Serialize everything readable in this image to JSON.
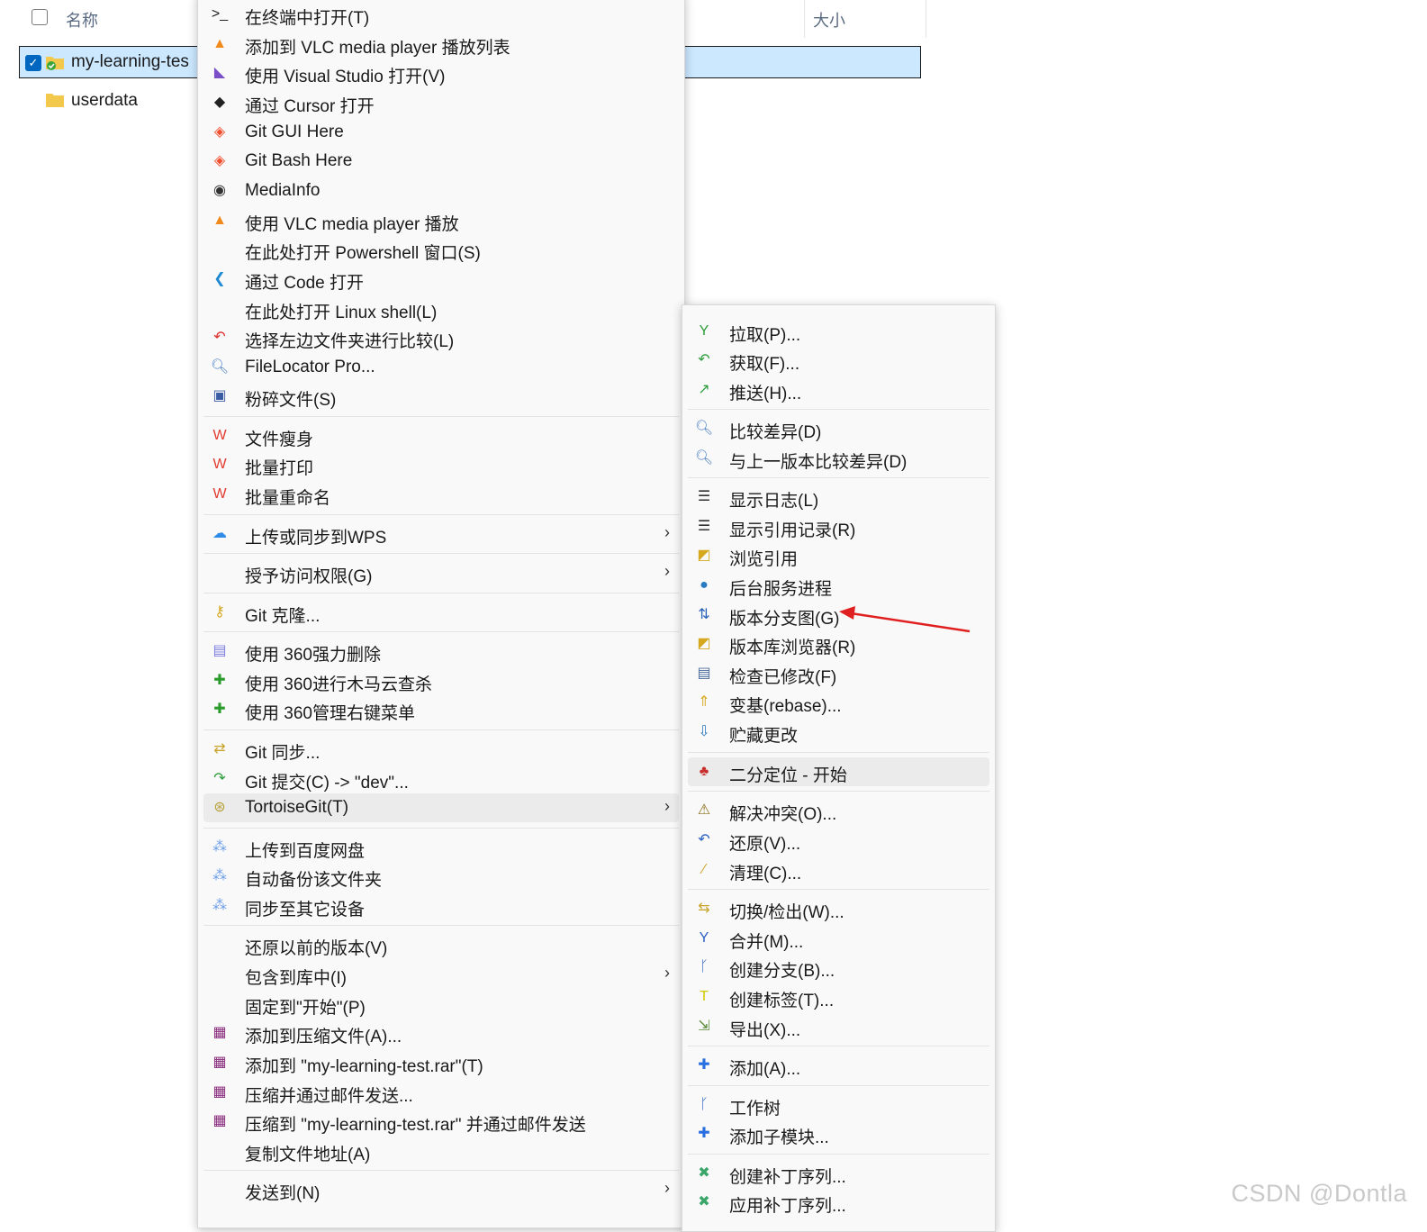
{
  "explorer": {
    "col_name": "名称",
    "col_size": "大小",
    "rows": [
      {
        "name": "my-learning-tes",
        "selected": true
      },
      {
        "name": "userdata",
        "selected": false
      }
    ]
  },
  "main_menu": {
    "items": [
      {
        "icon": "terminal-icon",
        "label": "在终端中打开(T)"
      },
      {
        "icon": "vlc-icon",
        "label": "添加到 VLC media player 播放列表"
      },
      {
        "icon": "visual-studio-icon",
        "label": "使用 Visual Studio 打开(V)"
      },
      {
        "icon": "cursor-icon",
        "label": "通过 Cursor 打开"
      },
      {
        "icon": "git-icon",
        "label": "Git GUI Here"
      },
      {
        "icon": "git-icon",
        "label": "Git Bash Here"
      },
      {
        "icon": "mediainfo-icon",
        "label": "MediaInfo"
      },
      {
        "icon": "vlc-icon",
        "label": "使用 VLC media player 播放"
      },
      {
        "icon": "",
        "label": "在此处打开 Powershell 窗口(S)"
      },
      {
        "icon": "vscode-icon",
        "label": "通过 Code 打开"
      },
      {
        "icon": "",
        "label": "在此处打开 Linux shell(L)"
      },
      {
        "icon": "compare-icon",
        "label": "选择左边文件夹进行比较(L)"
      },
      {
        "icon": "magnifier-icon",
        "label": "FileLocator Pro..."
      },
      {
        "icon": "shred-icon",
        "label": "粉碎文件(S)"
      },
      {
        "icon": "wps-icon",
        "label": "文件瘦身"
      },
      {
        "icon": "wps-icon",
        "label": "批量打印"
      },
      {
        "icon": "wps-icon",
        "label": "批量重命名"
      },
      {
        "icon": "cloud-icon",
        "label": "上传或同步到WPS",
        "sub": true
      },
      {
        "icon": "",
        "label": "授予访问权限(G)",
        "sub": true
      },
      {
        "icon": "git-clone-icon",
        "label": "Git 克隆..."
      },
      {
        "icon": "delete-360-icon",
        "label": "使用 360强力删除"
      },
      {
        "icon": "plus-360-icon",
        "label": "使用 360进行木马云查杀"
      },
      {
        "icon": "plus-360-icon",
        "label": "使用 360管理右键菜单"
      },
      {
        "icon": "git-sync-icon",
        "label": "Git 同步..."
      },
      {
        "icon": "git-commit-icon",
        "label": "Git 提交(C) -> \"dev\"..."
      },
      {
        "icon": "tortoise-icon",
        "label": "TortoiseGit(T)",
        "sub": true,
        "highlight": true
      },
      {
        "icon": "baidu-icon",
        "label": "上传到百度网盘"
      },
      {
        "icon": "baidu-icon",
        "label": "自动备份该文件夹"
      },
      {
        "icon": "baidu-icon",
        "label": "同步至其它设备"
      },
      {
        "icon": "",
        "label": "还原以前的版本(V)"
      },
      {
        "icon": "",
        "label": "包含到库中(I)",
        "sub": true
      },
      {
        "icon": "",
        "label": "固定到\"开始\"(P)"
      },
      {
        "icon": "rar-icon",
        "label": "添加到压缩文件(A)..."
      },
      {
        "icon": "rar-icon",
        "label": "添加到 \"my-learning-test.rar\"(T)"
      },
      {
        "icon": "rar-icon",
        "label": "压缩并通过邮件发送..."
      },
      {
        "icon": "rar-icon",
        "label": "压缩到 \"my-learning-test.rar\" 并通过邮件发送"
      },
      {
        "icon": "",
        "label": "复制文件地址(A)"
      },
      {
        "icon": "",
        "label": "发送到(N)",
        "sub": true
      }
    ]
  },
  "sub_menu": {
    "items": [
      {
        "icon": "pull-icon",
        "label": "拉取(P)..."
      },
      {
        "icon": "fetch-icon",
        "label": "获取(F)..."
      },
      {
        "icon": "push-icon",
        "label": "推送(H)..."
      },
      {
        "icon": "diff-icon",
        "label": "比较差异(D)"
      },
      {
        "icon": "diff-icon",
        "label": "与上一版本比较差异(D)"
      },
      {
        "icon": "log-icon",
        "label": "显示日志(L)"
      },
      {
        "icon": "log-icon",
        "label": "显示引用记录(R)"
      },
      {
        "icon": "refs-icon",
        "label": "浏览引用"
      },
      {
        "icon": "globe-icon",
        "label": "后台服务进程"
      },
      {
        "icon": "revision-graph-icon",
        "label": "版本分支图(G)"
      },
      {
        "icon": "repo-browser-icon",
        "label": "版本库浏览器(R)"
      },
      {
        "icon": "check-modified-icon",
        "label": "检查已修改(F)"
      },
      {
        "icon": "rebase-icon",
        "label": "变基(rebase)..."
      },
      {
        "icon": "stash-icon",
        "label": "贮藏更改"
      },
      {
        "icon": "bisect-icon",
        "label": "二分定位 - 开始",
        "highlight": true
      },
      {
        "icon": "resolve-icon",
        "label": "解决冲突(O)..."
      },
      {
        "icon": "revert-icon",
        "label": "还原(V)..."
      },
      {
        "icon": "cleanup-icon",
        "label": "清理(C)..."
      },
      {
        "icon": "switch-icon",
        "label": "切换/检出(W)..."
      },
      {
        "icon": "merge-icon",
        "label": "合并(M)..."
      },
      {
        "icon": "branch-icon",
        "label": "创建分支(B)..."
      },
      {
        "icon": "tag-icon",
        "label": "创建标签(T)..."
      },
      {
        "icon": "export-icon",
        "label": "导出(X)..."
      },
      {
        "icon": "add-icon",
        "label": "添加(A)..."
      },
      {
        "icon": "worktree-icon",
        "label": "工作树"
      },
      {
        "icon": "add-icon",
        "label": "添加子模块..."
      },
      {
        "icon": "patch-icon",
        "label": "创建补丁序列..."
      },
      {
        "icon": "patch-icon",
        "label": "应用补丁序列..."
      }
    ]
  },
  "watermark": "CSDN @Dontla",
  "colors": {
    "accent": "#0067c0",
    "selection": "#cce8ff",
    "annotation_arrow": "#e02020"
  }
}
